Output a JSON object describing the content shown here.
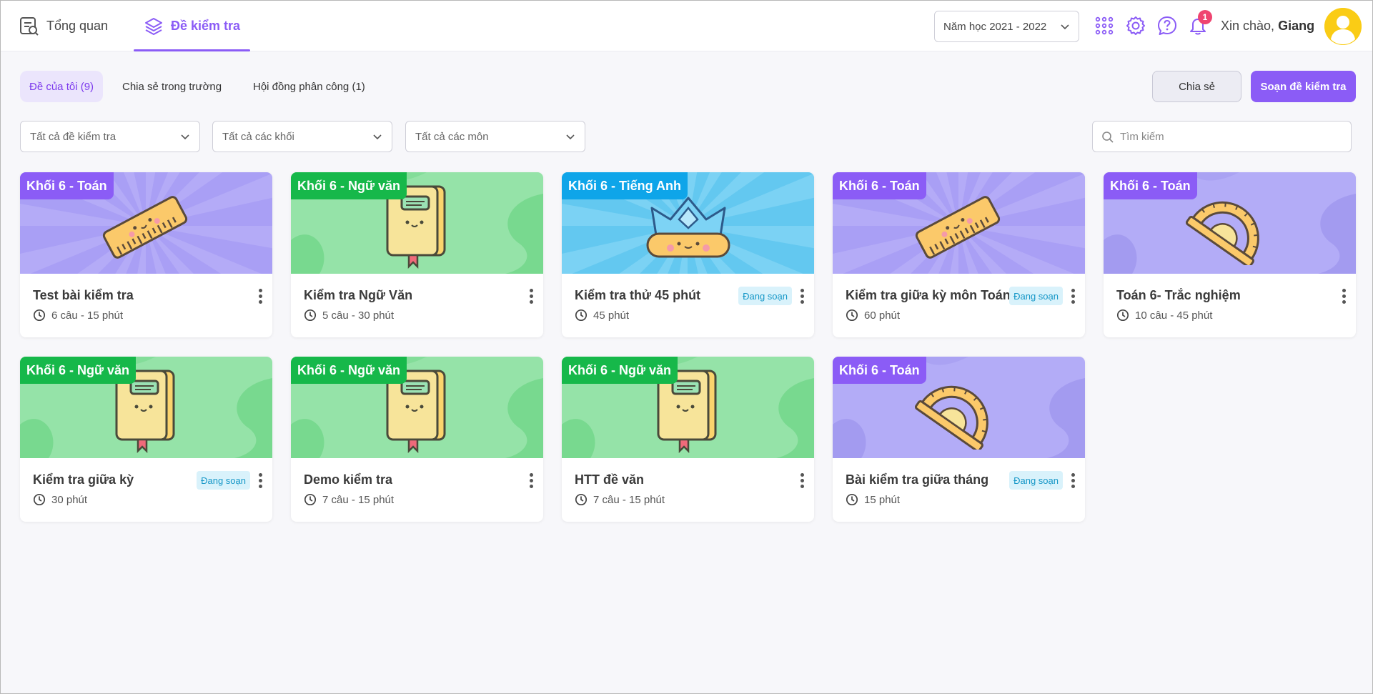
{
  "nav": {
    "overview_label": "Tổng quan",
    "tests_label": "Đề kiểm tra"
  },
  "header": {
    "year_select": "Năm học 2021 - 2022",
    "notification_count": "1",
    "greeting_prefix": "Xin chào,",
    "user_name": "Giang"
  },
  "tabs": {
    "my_tests": "Đề của tôi (9)",
    "shared_school": "Chia sẻ trong trường",
    "council": "Hội đồng phân công (1)"
  },
  "actions": {
    "share_label": "Chia sẻ",
    "compose_label": "Soạn đề kiểm tra"
  },
  "filters": {
    "all_tests": "Tất cả đề kiểm tra",
    "all_grades": "Tất cả các khối",
    "all_subjects": "Tất cả các môn",
    "search_placeholder": "Tìm kiếm"
  },
  "colors": {
    "accent": "#8b5cf6",
    "math_tag": "#8b5cf6",
    "literature_tag": "#16b84a",
    "english_tag": "#0ea5e9"
  },
  "cards": [
    {
      "tag": "Khối 6 - Toán",
      "title": "Test bài kiểm tra",
      "meta": "6 câu - 15 phút",
      "status": "",
      "theme": "math-rays",
      "icon": "ruler-icon"
    },
    {
      "tag": "Khối 6 - Ngữ văn",
      "title": "Kiểm tra Ngữ Văn",
      "meta": "5 câu - 30 phút",
      "status": "",
      "theme": "literature",
      "icon": "notebook-icon"
    },
    {
      "tag": "Khối 6 - Tiếng Anh",
      "title": "Kiểm tra thử 45 phút",
      "meta": "45 phút",
      "status": "Đang soạn",
      "theme": "english",
      "icon": "crown-icon"
    },
    {
      "tag": "Khối 6 - Toán",
      "title": "Kiểm tra giữa kỳ môn Toán",
      "meta": "60 phút",
      "status": "Đang soạn",
      "theme": "math-rays",
      "icon": "ruler-icon"
    },
    {
      "tag": "Khối 6 - Toán",
      "title": "Toán 6- Trắc nghiệm",
      "meta": "10 câu - 45 phút",
      "status": "",
      "theme": "math-blob",
      "icon": "protractor-icon"
    },
    {
      "tag": "Khối 6 - Ngữ văn",
      "title": "Kiểm tra giữa kỳ",
      "meta": "30 phút",
      "status": "Đang soạn",
      "theme": "literature",
      "icon": "notebook-icon"
    },
    {
      "tag": "Khối 6 - Ngữ văn",
      "title": "Demo kiểm tra",
      "meta": "7 câu - 15 phút",
      "status": "",
      "theme": "literature",
      "icon": "notebook-icon"
    },
    {
      "tag": "Khối 6 - Ngữ văn",
      "title": "HTT đề văn",
      "meta": "7 câu - 15 phút",
      "status": "",
      "theme": "literature",
      "icon": "notebook-icon"
    },
    {
      "tag": "Khối 6 - Toán",
      "title": "Bài kiểm tra giữa tháng",
      "meta": "15 phút",
      "status": "Đang soạn",
      "theme": "math-blob",
      "icon": "protractor-icon"
    }
  ]
}
